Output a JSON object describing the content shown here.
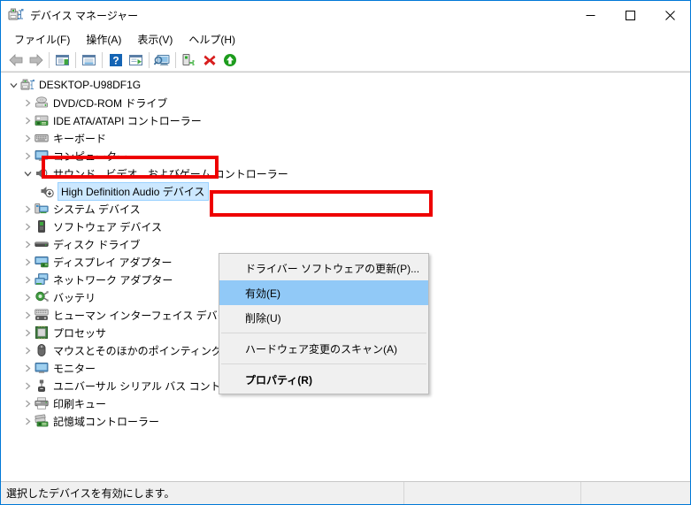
{
  "window": {
    "title": "デバイス マネージャー",
    "icon": "device-manager-icon",
    "accent_color": "#0078d7",
    "controls": {
      "minimize": "minimize-icon",
      "maximize": "maximize-icon",
      "close": "close-icon"
    }
  },
  "menubar": {
    "items": [
      {
        "label": "ファイル(F)"
      },
      {
        "label": "操作(A)"
      },
      {
        "label": "表示(V)"
      },
      {
        "label": "ヘルプ(H)"
      }
    ]
  },
  "toolbar": {
    "buttons": [
      {
        "name": "back-arrow-icon",
        "type": "back"
      },
      {
        "name": "forward-arrow-icon",
        "type": "forward"
      },
      {
        "name": "separator",
        "type": "sep"
      },
      {
        "name": "show-hidden-devices-icon",
        "type": "panel-green"
      },
      {
        "name": "separator",
        "type": "sep"
      },
      {
        "name": "properties-icon",
        "type": "panel-blue"
      },
      {
        "name": "separator",
        "type": "sep"
      },
      {
        "name": "help-icon",
        "type": "help"
      },
      {
        "name": "update-driver-icon",
        "type": "panel-play"
      },
      {
        "name": "separator",
        "type": "sep"
      },
      {
        "name": "scan-hardware-changes-icon",
        "type": "monitor-scan"
      },
      {
        "name": "separator",
        "type": "sep"
      },
      {
        "name": "add-legacy-hardware-icon",
        "type": "add-device"
      },
      {
        "name": "uninstall-device-icon",
        "type": "red-x"
      },
      {
        "name": "enable-device-icon",
        "type": "green-up"
      }
    ]
  },
  "tree": {
    "root": {
      "label": "DESKTOP-U98DF1G",
      "icon": "computer-icon",
      "expanded": true
    },
    "items": [
      {
        "label": "DVD/CD-ROM ドライブ",
        "icon": "dvd-drive-icon",
        "level": 1,
        "expanded": false
      },
      {
        "label": "IDE ATA/ATAPI コントローラー",
        "icon": "ide-controller-icon",
        "level": 1,
        "expanded": false
      },
      {
        "label": "キーボード",
        "icon": "keyboard-icon",
        "level": 1,
        "expanded": false
      },
      {
        "label": "コンピューター",
        "icon": "monitor-icon",
        "level": 1,
        "expanded": false
      },
      {
        "label": "サウンド、ビデオ、およびゲーム コントローラー",
        "icon": "speaker-icon",
        "level": 1,
        "expanded": true
      },
      {
        "label": "High Definition Audio デバイス",
        "icon": "audio-device-disabled-icon",
        "level": 2,
        "selected": true
      },
      {
        "label": "システム デバイス",
        "icon": "system-device-icon",
        "level": 1,
        "expanded": false
      },
      {
        "label": "ソフトウェア デバイス",
        "icon": "software-device-icon",
        "level": 1,
        "expanded": false
      },
      {
        "label": "ディスク ドライブ",
        "icon": "disk-drive-icon",
        "level": 1,
        "expanded": false
      },
      {
        "label": "ディスプレイ アダプター",
        "icon": "display-adapter-icon",
        "level": 1,
        "expanded": false
      },
      {
        "label": "ネットワーク アダプター",
        "icon": "network-adapter-icon",
        "level": 1,
        "expanded": false
      },
      {
        "label": "バッテリ",
        "icon": "battery-icon",
        "level": 1,
        "expanded": false
      },
      {
        "label": "ヒューマン インターフェイス デバイス",
        "icon": "hid-icon",
        "level": 1,
        "expanded": false
      },
      {
        "label": "プロセッサ",
        "icon": "processor-icon",
        "level": 1,
        "expanded": false
      },
      {
        "label": "マウスとそのほかのポインティング デバイス",
        "icon": "mouse-icon",
        "level": 1,
        "expanded": false
      },
      {
        "label": "モニター",
        "icon": "monitor-icon",
        "level": 1,
        "expanded": false
      },
      {
        "label": "ユニバーサル シリアル バス コントローラー",
        "icon": "usb-icon",
        "level": 1,
        "expanded": false
      },
      {
        "label": "印刷キュー",
        "icon": "printer-icon",
        "level": 1,
        "expanded": false
      },
      {
        "label": "記憶域コントローラー",
        "icon": "storage-controller-icon",
        "level": 1,
        "expanded": false
      }
    ]
  },
  "context_menu": {
    "items": [
      {
        "label": "ドライバー ソフトウェアの更新(P)...",
        "type": "item"
      },
      {
        "label": "有効(E)",
        "type": "item",
        "highlighted": true
      },
      {
        "label": "削除(U)",
        "type": "item"
      },
      {
        "type": "separator"
      },
      {
        "label": "ハードウェア変更のスキャン(A)",
        "type": "item"
      },
      {
        "type": "separator"
      },
      {
        "label": "プロパティ(R)",
        "type": "item",
        "bold": true
      }
    ]
  },
  "annotations": {
    "highlight_color": "#ee0000",
    "boxes": [
      {
        "name": "selected-device-highlight",
        "target": "High Definition Audio デバイス"
      },
      {
        "name": "enable-menu-item-highlight",
        "target": "有効(E)"
      }
    ]
  },
  "statusbar": {
    "message": "選択したデバイスを有効にします。",
    "cell2": "",
    "cell3": ""
  }
}
